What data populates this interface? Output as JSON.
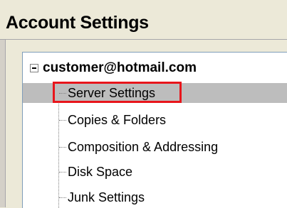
{
  "window": {
    "title": "Account Settings"
  },
  "tree": {
    "account": "customer@hotmail.com",
    "items": [
      {
        "label": "Server Settings",
        "selected": true
      },
      {
        "label": "Copies & Folders",
        "selected": false
      },
      {
        "label": "Composition & Addressing",
        "selected": false
      },
      {
        "label": "Disk Space",
        "selected": false
      },
      {
        "label": "Junk Settings",
        "selected": false
      }
    ]
  },
  "colors": {
    "highlight": "#e8151b",
    "selection": "#bdbdbd",
    "tree_border": "#7f9db9"
  }
}
